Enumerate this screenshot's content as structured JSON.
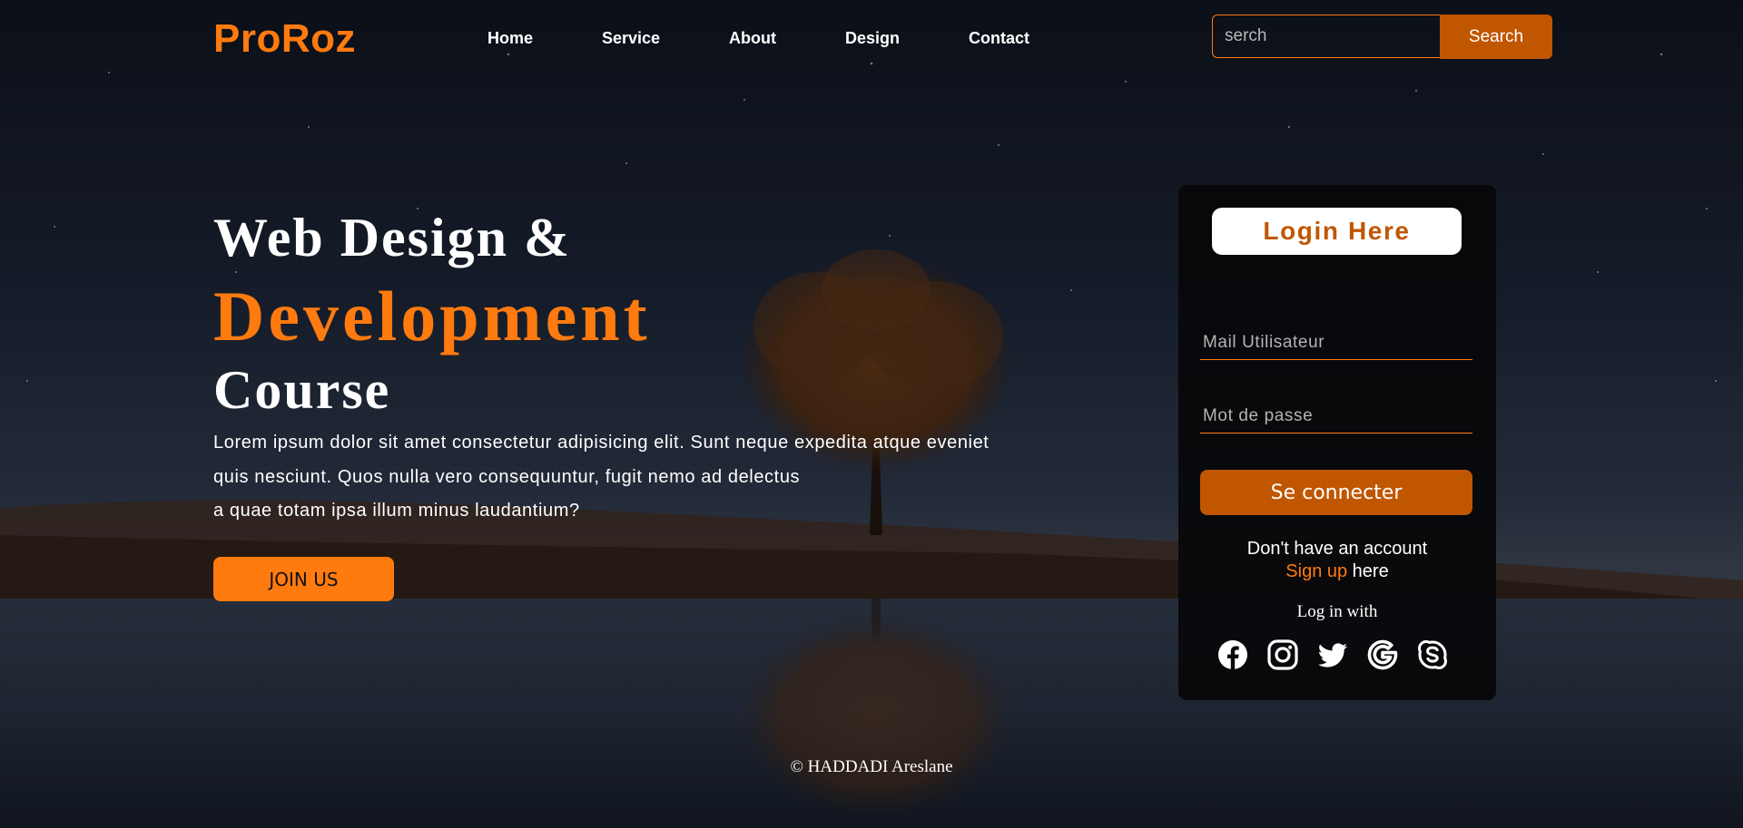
{
  "brand": {
    "logo": "ProRoz"
  },
  "nav": {
    "items": [
      "Home",
      "Service",
      "About",
      "Design",
      "Contact"
    ]
  },
  "search": {
    "placeholder": "serch",
    "button_label": "Search"
  },
  "hero": {
    "title_line1": "Web Design &",
    "title_line2": "Development",
    "title_line3": "Course",
    "paragraph_lines": [
      "Lorem ipsum dolor sit amet consectetur adipisicing elit. Sunt neque expedita atque eveniet",
      "quis nesciunt. Quos nulla vero consequuntur, fugit nemo ad delectus",
      "a quae totam ipsa illum minus laudantium?"
    ],
    "join_label": "JOIN US"
  },
  "login": {
    "title": "Login Here",
    "email_placeholder": "Mail Utilisateur",
    "password_placeholder": "Mot de passe",
    "connect_label": "Se connecter",
    "no_account_text": "Don't have an account",
    "signup_link": "Sign up",
    "signup_suffix": " here",
    "login_with": "Log in with",
    "social_icons": [
      "facebook-icon",
      "instagram-icon",
      "twitter-icon",
      "google-icon",
      "skype-icon"
    ]
  },
  "footer": {
    "copyright": "© HADDADI Areslane"
  },
  "colors": {
    "accent": "#ff7a0f",
    "accent_dark": "#c05600",
    "card_bg": "#0a0a0c",
    "sky": "#141a26"
  }
}
